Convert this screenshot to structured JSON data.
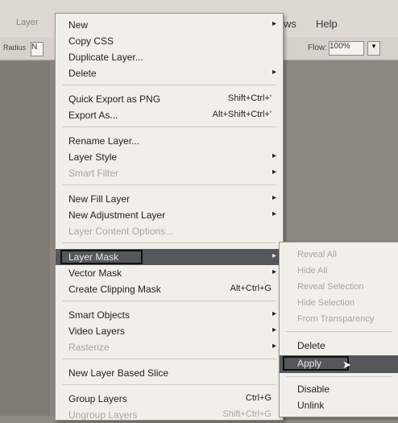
{
  "menubar": {
    "help_label": "Help",
    "partial_label": "ws",
    "left_tab_label": "Layer"
  },
  "toolbar": {
    "left_label": "Radius",
    "left_field": "N",
    "flow_label": "Flow:",
    "flow_value": "100%"
  },
  "menu": {
    "items": [
      {
        "label": "New",
        "arrow": true,
        "enabled": true
      },
      {
        "label": "Copy CSS",
        "enabled": true
      },
      {
        "label": "Duplicate Layer...",
        "enabled": true
      },
      {
        "label": "Delete",
        "arrow": true,
        "enabled": true
      },
      {
        "label": "Quick Export as PNG",
        "shortcut": "Shift+Ctrl+'",
        "enabled": true
      },
      {
        "label": "Export As...",
        "shortcut": "Alt+Shift+Ctrl+'",
        "enabled": true
      },
      {
        "label": "Rename Layer...",
        "enabled": true
      },
      {
        "label": "Layer Style",
        "arrow": true,
        "enabled": true
      },
      {
        "label": "Smart Filter",
        "arrow": true,
        "enabled": false
      },
      {
        "label": "New Fill Layer",
        "arrow": true,
        "enabled": true
      },
      {
        "label": "New Adjustment Layer",
        "arrow": true,
        "enabled": true
      },
      {
        "label": "Layer Content Options...",
        "enabled": false
      },
      {
        "label": "Layer Mask",
        "arrow": true,
        "enabled": true,
        "highlighted": true
      },
      {
        "label": "Vector Mask",
        "arrow": true,
        "enabled": true
      },
      {
        "label": "Create Clipping Mask",
        "shortcut": "Alt+Ctrl+G",
        "enabled": true
      },
      {
        "label": "Smart Objects",
        "arrow": true,
        "enabled": true
      },
      {
        "label": "Video Layers",
        "arrow": true,
        "enabled": true
      },
      {
        "label": "Rasterize",
        "arrow": true,
        "enabled": false
      },
      {
        "label": "New Layer Based Slice",
        "enabled": true
      },
      {
        "label": "Group Layers",
        "shortcut": "Ctrl+G",
        "enabled": true
      },
      {
        "label": "Ungroup Layers",
        "shortcut": "Shift+Ctrl+G",
        "enabled": false
      }
    ]
  },
  "submenu": {
    "items": [
      {
        "label": "Reveal All",
        "enabled": false
      },
      {
        "label": "Hide All",
        "enabled": false
      },
      {
        "label": "Reveal Selection",
        "enabled": false
      },
      {
        "label": "Hide Selection",
        "enabled": false
      },
      {
        "label": "From Transparency",
        "enabled": false
      },
      {
        "label": "Delete",
        "enabled": true
      },
      {
        "label": "Apply",
        "enabled": true,
        "highlighted": true
      },
      {
        "label": "Disable",
        "enabled": true
      },
      {
        "label": "Unlink",
        "enabled": true
      }
    ]
  },
  "colors": {
    "highlight": "#56575a",
    "menu_bg": "#f1efea"
  }
}
